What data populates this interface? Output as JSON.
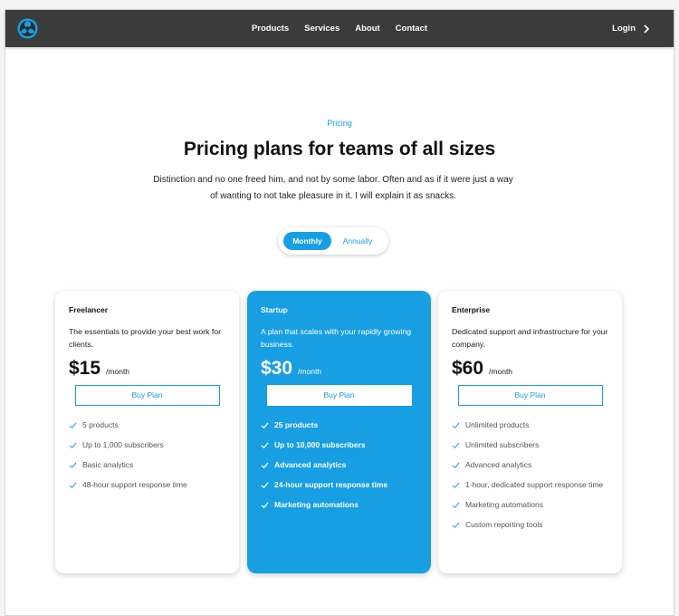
{
  "nav": {
    "links": [
      "Products",
      "Services",
      "About",
      "Contact"
    ],
    "login_label": "Login",
    "background": "#3b3b3b"
  },
  "hero": {
    "eyebrow": "Pricing",
    "title": "Pricing plans for teams of all sizes",
    "subtitle_line1": "Distinction and no one freed him, and not by some labor. Often and as if it were just a way",
    "subtitle_line2": "of wanting to not take pleasure in it. I will explain it as snacks."
  },
  "billing_toggle": {
    "active": "Monthly",
    "inactive": "Annually"
  },
  "accent_color": "#189fe3",
  "plans": [
    {
      "name": "Freelancer",
      "description": "The essentials to provide your best work for clients.",
      "price": "$15",
      "period": "/month",
      "button": "Buy Plan",
      "features": [
        "5 products",
        "Up to 1,000 subscribers",
        "Basic analytics",
        "48-hour support response time"
      ]
    },
    {
      "name": "Startup",
      "description": "A plan that scales with your rapidly growing business.",
      "price": "$30",
      "period": "/month",
      "button": "Buy Plan",
      "features": [
        "25 products",
        "Up to 10,000 subscribers",
        "Advanced analytics",
        "24-hour support response time",
        "Marketing automations"
      ]
    },
    {
      "name": "Enterprise",
      "description": "Dedicated support and infrastructure for your company.",
      "price": "$60",
      "period": "/month",
      "button": "Buy Plan",
      "features": [
        "Unlimited products",
        "Unlimited subscribers",
        "Advanced analytics",
        "1-hour, dedicated support response time",
        "Marketing automations",
        "Custom reporting tools"
      ]
    }
  ]
}
